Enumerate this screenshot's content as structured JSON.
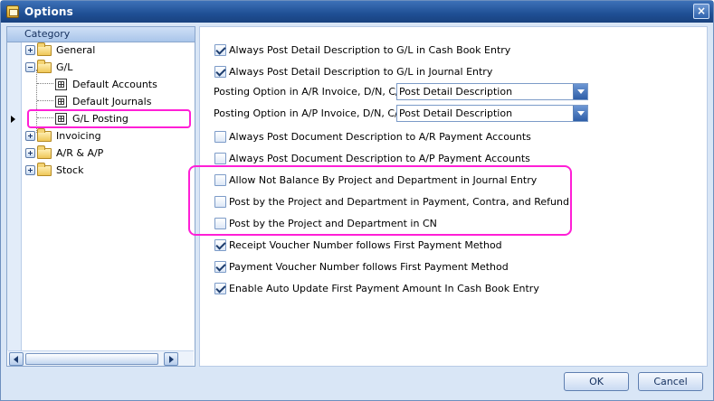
{
  "window": {
    "title": "Options",
    "close_glyph": "×"
  },
  "tree": {
    "header": "Category",
    "items": [
      {
        "label": "General"
      },
      {
        "label": "G/L"
      },
      {
        "label": "Default Accounts"
      },
      {
        "label": "Default Journals"
      },
      {
        "label": "G/L Posting"
      },
      {
        "label": "Invoicing"
      },
      {
        "label": "A/R & A/P"
      },
      {
        "label": "Stock"
      }
    ]
  },
  "settings": {
    "options": [
      {
        "label": "Always Post Detail Description to G/L in Cash Book Entry",
        "checked": true
      },
      {
        "label": "Always Post Detail Description to G/L in Journal Entry",
        "checked": true
      },
      {
        "label": "Always Post Document Description to A/R Payment Accounts",
        "checked": false
      },
      {
        "label": "Always Post Document Description to A/P Payment Accounts",
        "checked": false
      },
      {
        "label": "Allow Not Balance By Project and Department in Journal Entry",
        "checked": false
      },
      {
        "label": "Post by the Project and Department in Payment, Contra, and Refund",
        "checked": false
      },
      {
        "label": "Post by the Project and Department in CN",
        "checked": false
      },
      {
        "label": "Receipt Voucher Number follows First Payment Method",
        "checked": true
      },
      {
        "label": "Payment Voucher Number follows First Payment Method",
        "checked": true
      },
      {
        "label": "Enable Auto Update First Payment Amount In Cash Book Entry",
        "checked": true
      }
    ],
    "selects": [
      {
        "label": "Posting Option in A/R Invoice, D/N, C/N",
        "value": "Post Detail Description"
      },
      {
        "label": "Posting Option in A/P Invoice, D/N, C/N",
        "value": "Post Detail Description"
      }
    ]
  },
  "footer": {
    "ok_label": "OK",
    "cancel_label": "Cancel"
  },
  "colors": {
    "title_bar": "#1f4f94",
    "highlight": "#ff1fd6",
    "window_background": "#d9e6f6"
  },
  "icons": {
    "app": "options-app-icon",
    "close": "close-icon",
    "folder": "folder-icon",
    "document": "grid-document-icon",
    "dropdown": "chevron-down-icon"
  }
}
